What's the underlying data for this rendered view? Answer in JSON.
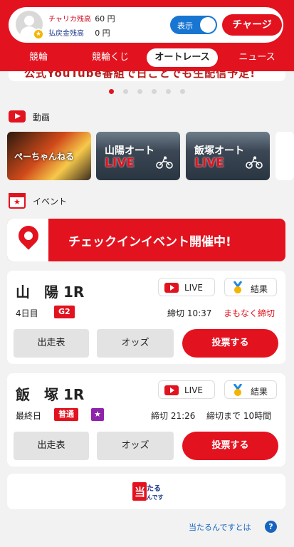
{
  "header": {
    "balances": [
      {
        "label": "チャリカ残高",
        "value": "60 円"
      },
      {
        "label": "払戻金残高",
        "value": "0 円"
      }
    ],
    "toggle_label": "表示",
    "charge_label": "チャージ",
    "colors": {
      "brand": "#e2131f",
      "toggle": "#1876d2"
    }
  },
  "tabs": [
    {
      "label": "競輪",
      "active": false
    },
    {
      "label": "競輪くじ",
      "active": false
    },
    {
      "label": "オートレース",
      "active": true
    },
    {
      "label": "ニュース",
      "active": false
    }
  ],
  "banner": {
    "text": "公式YouTube番組で日ごとでも生配信予定!",
    "slide_count": 8,
    "active_slide": 1
  },
  "videos": {
    "section_label": "動画",
    "items": [
      {
        "title": "ぺーちゃんねる",
        "live": ""
      },
      {
        "title": "山陽オート",
        "live": "LIVE"
      },
      {
        "title": "飯塚オート",
        "live": "LIVE"
      }
    ]
  },
  "events": {
    "section_label": "イベント",
    "checkin_text": "チェックインイベント開催中!"
  },
  "races": [
    {
      "name": "山　陽 1R",
      "live_label": "LIVE",
      "result_label": "結果",
      "day": "4日目",
      "grade": "G2",
      "star": false,
      "deadline": "締切 10:37",
      "status": "まもなく締切",
      "actions": {
        "entries": "出走表",
        "odds": "オッズ",
        "vote": "投票する"
      }
    },
    {
      "name": "飯　塚 1R",
      "live_label": "LIVE",
      "result_label": "結果",
      "day": "最終日",
      "grade": "普通",
      "star": true,
      "deadline": "締切 21:26",
      "status": "締切まで 10時間",
      "actions": {
        "entries": "出走表",
        "odds": "オッズ",
        "vote": "投票する"
      }
    }
  ],
  "atarun": {
    "logo_text": "当たるんです",
    "link_text": "当たるんですとは",
    "help_icon": "?"
  }
}
